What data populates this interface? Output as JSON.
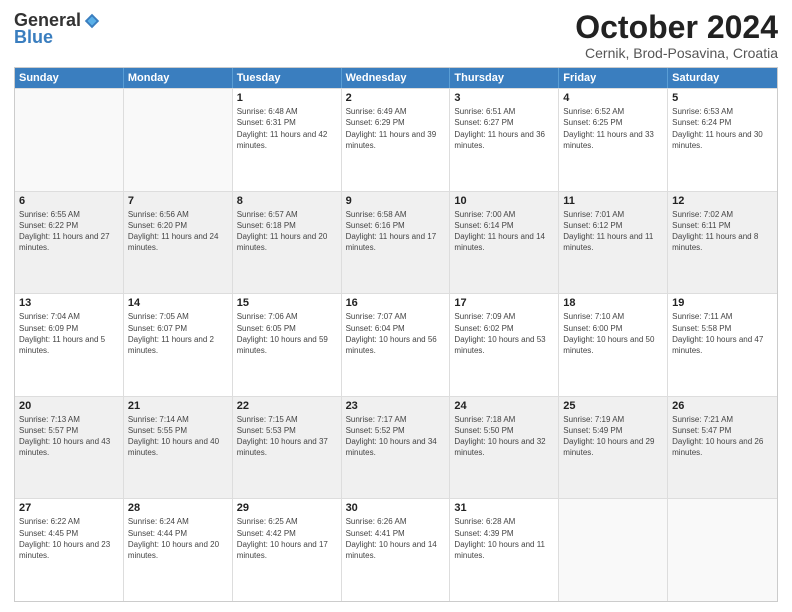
{
  "logo": {
    "general": "General",
    "blue": "Blue"
  },
  "title": "October 2024",
  "location": "Cernik, Brod-Posavina, Croatia",
  "days": [
    "Sunday",
    "Monday",
    "Tuesday",
    "Wednesday",
    "Thursday",
    "Friday",
    "Saturday"
  ],
  "rows": [
    [
      {
        "day": "",
        "sunrise": "",
        "sunset": "",
        "daylight": "",
        "empty": true
      },
      {
        "day": "",
        "sunrise": "",
        "sunset": "",
        "daylight": "",
        "empty": true
      },
      {
        "day": "1",
        "sunrise": "Sunrise: 6:48 AM",
        "sunset": "Sunset: 6:31 PM",
        "daylight": "Daylight: 11 hours and 42 minutes."
      },
      {
        "day": "2",
        "sunrise": "Sunrise: 6:49 AM",
        "sunset": "Sunset: 6:29 PM",
        "daylight": "Daylight: 11 hours and 39 minutes."
      },
      {
        "day": "3",
        "sunrise": "Sunrise: 6:51 AM",
        "sunset": "Sunset: 6:27 PM",
        "daylight": "Daylight: 11 hours and 36 minutes."
      },
      {
        "day": "4",
        "sunrise": "Sunrise: 6:52 AM",
        "sunset": "Sunset: 6:25 PM",
        "daylight": "Daylight: 11 hours and 33 minutes."
      },
      {
        "day": "5",
        "sunrise": "Sunrise: 6:53 AM",
        "sunset": "Sunset: 6:24 PM",
        "daylight": "Daylight: 11 hours and 30 minutes."
      }
    ],
    [
      {
        "day": "6",
        "sunrise": "Sunrise: 6:55 AM",
        "sunset": "Sunset: 6:22 PM",
        "daylight": "Daylight: 11 hours and 27 minutes."
      },
      {
        "day": "7",
        "sunrise": "Sunrise: 6:56 AM",
        "sunset": "Sunset: 6:20 PM",
        "daylight": "Daylight: 11 hours and 24 minutes."
      },
      {
        "day": "8",
        "sunrise": "Sunrise: 6:57 AM",
        "sunset": "Sunset: 6:18 PM",
        "daylight": "Daylight: 11 hours and 20 minutes."
      },
      {
        "day": "9",
        "sunrise": "Sunrise: 6:58 AM",
        "sunset": "Sunset: 6:16 PM",
        "daylight": "Daylight: 11 hours and 17 minutes."
      },
      {
        "day": "10",
        "sunrise": "Sunrise: 7:00 AM",
        "sunset": "Sunset: 6:14 PM",
        "daylight": "Daylight: 11 hours and 14 minutes."
      },
      {
        "day": "11",
        "sunrise": "Sunrise: 7:01 AM",
        "sunset": "Sunset: 6:12 PM",
        "daylight": "Daylight: 11 hours and 11 minutes."
      },
      {
        "day": "12",
        "sunrise": "Sunrise: 7:02 AM",
        "sunset": "Sunset: 6:11 PM",
        "daylight": "Daylight: 11 hours and 8 minutes."
      }
    ],
    [
      {
        "day": "13",
        "sunrise": "Sunrise: 7:04 AM",
        "sunset": "Sunset: 6:09 PM",
        "daylight": "Daylight: 11 hours and 5 minutes."
      },
      {
        "day": "14",
        "sunrise": "Sunrise: 7:05 AM",
        "sunset": "Sunset: 6:07 PM",
        "daylight": "Daylight: 11 hours and 2 minutes."
      },
      {
        "day": "15",
        "sunrise": "Sunrise: 7:06 AM",
        "sunset": "Sunset: 6:05 PM",
        "daylight": "Daylight: 10 hours and 59 minutes."
      },
      {
        "day": "16",
        "sunrise": "Sunrise: 7:07 AM",
        "sunset": "Sunset: 6:04 PM",
        "daylight": "Daylight: 10 hours and 56 minutes."
      },
      {
        "day": "17",
        "sunrise": "Sunrise: 7:09 AM",
        "sunset": "Sunset: 6:02 PM",
        "daylight": "Daylight: 10 hours and 53 minutes."
      },
      {
        "day": "18",
        "sunrise": "Sunrise: 7:10 AM",
        "sunset": "Sunset: 6:00 PM",
        "daylight": "Daylight: 10 hours and 50 minutes."
      },
      {
        "day": "19",
        "sunrise": "Sunrise: 7:11 AM",
        "sunset": "Sunset: 5:58 PM",
        "daylight": "Daylight: 10 hours and 47 minutes."
      }
    ],
    [
      {
        "day": "20",
        "sunrise": "Sunrise: 7:13 AM",
        "sunset": "Sunset: 5:57 PM",
        "daylight": "Daylight: 10 hours and 43 minutes."
      },
      {
        "day": "21",
        "sunrise": "Sunrise: 7:14 AM",
        "sunset": "Sunset: 5:55 PM",
        "daylight": "Daylight: 10 hours and 40 minutes."
      },
      {
        "day": "22",
        "sunrise": "Sunrise: 7:15 AM",
        "sunset": "Sunset: 5:53 PM",
        "daylight": "Daylight: 10 hours and 37 minutes."
      },
      {
        "day": "23",
        "sunrise": "Sunrise: 7:17 AM",
        "sunset": "Sunset: 5:52 PM",
        "daylight": "Daylight: 10 hours and 34 minutes."
      },
      {
        "day": "24",
        "sunrise": "Sunrise: 7:18 AM",
        "sunset": "Sunset: 5:50 PM",
        "daylight": "Daylight: 10 hours and 32 minutes."
      },
      {
        "day": "25",
        "sunrise": "Sunrise: 7:19 AM",
        "sunset": "Sunset: 5:49 PM",
        "daylight": "Daylight: 10 hours and 29 minutes."
      },
      {
        "day": "26",
        "sunrise": "Sunrise: 7:21 AM",
        "sunset": "Sunset: 5:47 PM",
        "daylight": "Daylight: 10 hours and 26 minutes."
      }
    ],
    [
      {
        "day": "27",
        "sunrise": "Sunrise: 6:22 AM",
        "sunset": "Sunset: 4:45 PM",
        "daylight": "Daylight: 10 hours and 23 minutes."
      },
      {
        "day": "28",
        "sunrise": "Sunrise: 6:24 AM",
        "sunset": "Sunset: 4:44 PM",
        "daylight": "Daylight: 10 hours and 20 minutes."
      },
      {
        "day": "29",
        "sunrise": "Sunrise: 6:25 AM",
        "sunset": "Sunset: 4:42 PM",
        "daylight": "Daylight: 10 hours and 17 minutes."
      },
      {
        "day": "30",
        "sunrise": "Sunrise: 6:26 AM",
        "sunset": "Sunset: 4:41 PM",
        "daylight": "Daylight: 10 hours and 14 minutes."
      },
      {
        "day": "31",
        "sunrise": "Sunrise: 6:28 AM",
        "sunset": "Sunset: 4:39 PM",
        "daylight": "Daylight: 10 hours and 11 minutes."
      },
      {
        "day": "",
        "sunrise": "",
        "sunset": "",
        "daylight": "",
        "empty": true
      },
      {
        "day": "",
        "sunrise": "",
        "sunset": "",
        "daylight": "",
        "empty": true
      }
    ]
  ]
}
